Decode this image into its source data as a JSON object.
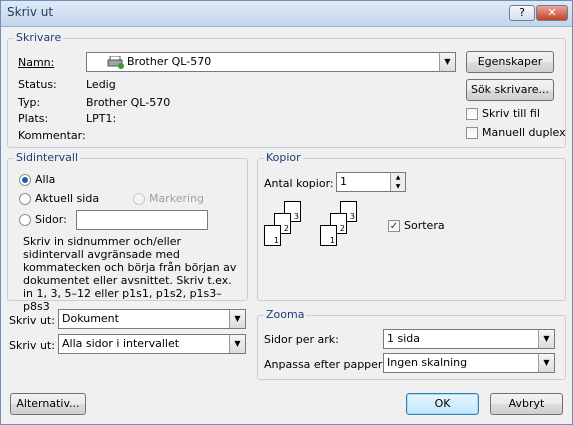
{
  "window": {
    "title": "Skriv ut"
  },
  "title_buttons": {
    "help": "?",
    "close": "✕"
  },
  "printer": {
    "legend": "Skrivare",
    "name_label": "Namn:",
    "name_value": "Brother QL-570",
    "status_label": "Status:",
    "status_value": "Ledig",
    "type_label": "Typ:",
    "type_value": "Brother QL-570",
    "location_label": "Plats:",
    "location_value": "LPT1:",
    "comment_label": "Kommentar:",
    "properties_button": "Egenskaper",
    "find_printer_button": "Sök skrivare...",
    "print_to_file_label": "Skriv till fil",
    "manual_duplex_label": "Manuell duplex"
  },
  "page_range": {
    "legend": "Sidintervall",
    "all_label": "Alla",
    "current_page_label": "Aktuell sida",
    "selection_label": "Markering",
    "pages_label": "Sidor:",
    "pages_value": "",
    "help_text": "Skriv in sidnummer och/eller sidintervall avgränsade med kommatecken och börja från början av dokumentet eller avsnittet. Skriv t.ex. in 1, 3, 5–12 eller p1s1, p1s2, p1s3–p8s3"
  },
  "copies": {
    "legend": "Kopior",
    "count_label": "Antal kopior:",
    "count_value": "1",
    "collate_label": "Sortera",
    "collate_checked": true,
    "page_numbers": [
      "1",
      "2",
      "3"
    ]
  },
  "print_what": {
    "label": "Skriv ut:",
    "value": "Dokument"
  },
  "print_range": {
    "label": "Skriv ut:",
    "value": "Alla sidor i intervallet"
  },
  "zoom": {
    "legend": "Zooma",
    "pages_per_sheet_label": "Sidor per ark:",
    "pages_per_sheet_value": "1 sida",
    "scale_label": "Anpassa efter papper:",
    "scale_value": "Ingen skalning"
  },
  "footer": {
    "options_button": "Alternativ...",
    "ok_button": "OK",
    "cancel_button": "Avbryt"
  }
}
